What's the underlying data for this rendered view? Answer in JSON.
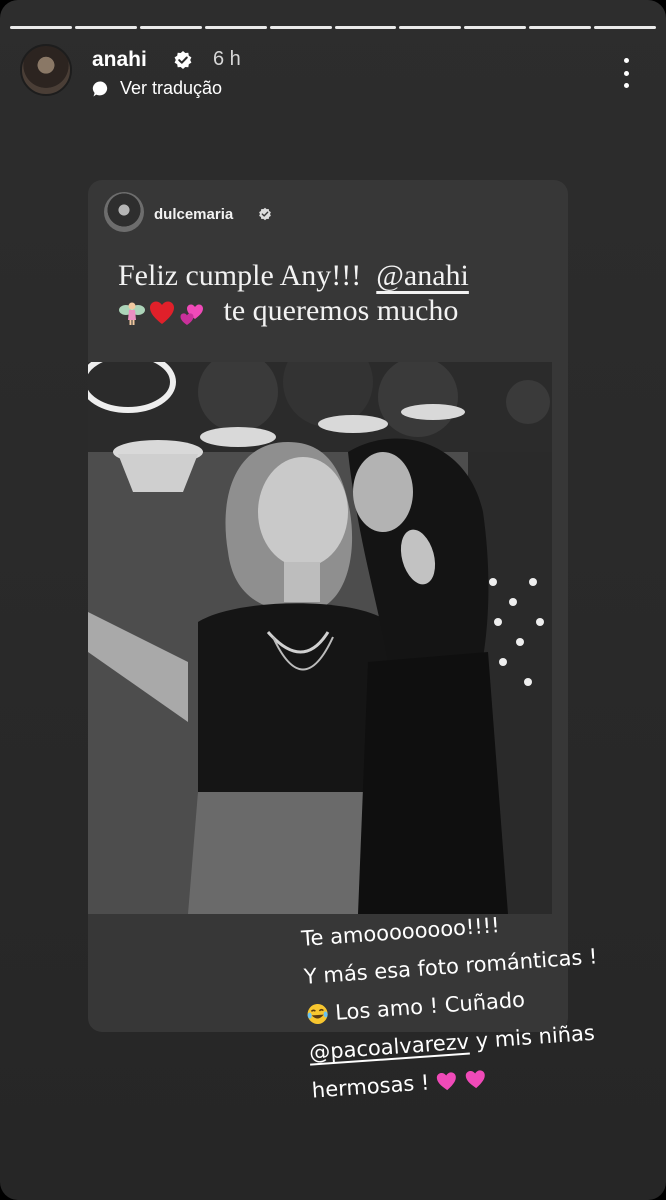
{
  "story": {
    "progress_segments": 10,
    "active_segment": 10
  },
  "header": {
    "username": "anahi",
    "time": "6 h",
    "translate_label": "Ver tradução"
  },
  "card": {
    "username": "dulcemaria",
    "caption_line1": "Feliz cumple Any!!!",
    "caption_mention": "@anahi",
    "caption_line2": "te queremos mucho"
  },
  "overlay": {
    "line1": "Te amoooooooo!!!!",
    "line2": "Y más esa foto románticas !",
    "line3": "Los amo ! Cuñado",
    "mention": "@pacoalvarezv",
    "line4_suffix": "y mis niñas",
    "line5": "hermosas !"
  },
  "colors": {
    "background": "#2a2a2a",
    "card": "#373737",
    "pink_heart": "#f04ab8",
    "red_heart": "#e0202a"
  },
  "icons": [
    "verified-badge-icon",
    "translate-bubble-icon",
    "more-options-icon",
    "fairy-emoji",
    "red-heart-emoji",
    "two-hearts-emoji",
    "laughing-tears-emoji",
    "pink-heart-emoji"
  ]
}
